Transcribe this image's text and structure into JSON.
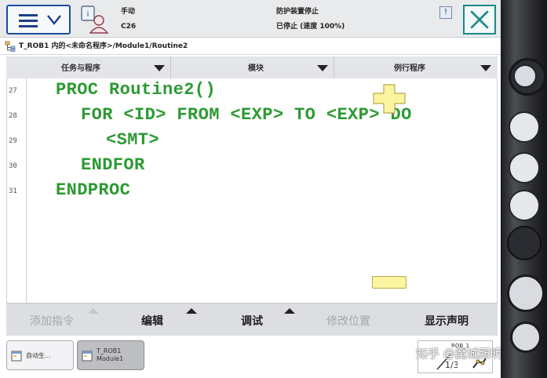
{
  "topbar": {
    "mode": "手动",
    "controller": "C26",
    "safety_state": "防护装置停止",
    "run_state": "已停止 (速度 100%)"
  },
  "title": {
    "path": "T_ROB1 内的<未命名程序>/Module1/Routine2"
  },
  "nav": {
    "tabs": [
      {
        "label": "任务与程序"
      },
      {
        "label": "模块"
      },
      {
        "label": "例行程序"
      }
    ]
  },
  "editor": {
    "lines": [
      {
        "num": "27",
        "code": "PROC Routine2()"
      },
      {
        "num": "28",
        "code": "FOR <ID> FROM <EXP> TO <EXP> DO"
      },
      {
        "num": "29",
        "code": "<SMT>"
      },
      {
        "num": "30",
        "code": "ENDFOR"
      },
      {
        "num": "31",
        "code": "ENDPROC"
      }
    ],
    "code_color": "#2c9a32"
  },
  "commands": {
    "add_instruction": "添加指令",
    "edit": "编辑",
    "debug": "调试",
    "modify_position": "修改位置",
    "show_declaration": "显示声明"
  },
  "taskbar": {
    "task1_label": "自动生...",
    "task2_line1": "T_ROB1",
    "task2_line2": "Module1",
    "rob_label": "ROB_1",
    "speed_fraction": "1/3"
  },
  "watermark": "知乎 @魔城照明",
  "colors": {
    "menu_border": "#1a4fa0",
    "close_border": "#1a8a87",
    "marker_yellow": "#fbf4a0"
  },
  "icons": [
    "hamburger-menu-icon",
    "chevron-down-icon",
    "operator-info-icon",
    "close-icon",
    "program-tree-icon",
    "plus-cross-icon"
  ]
}
